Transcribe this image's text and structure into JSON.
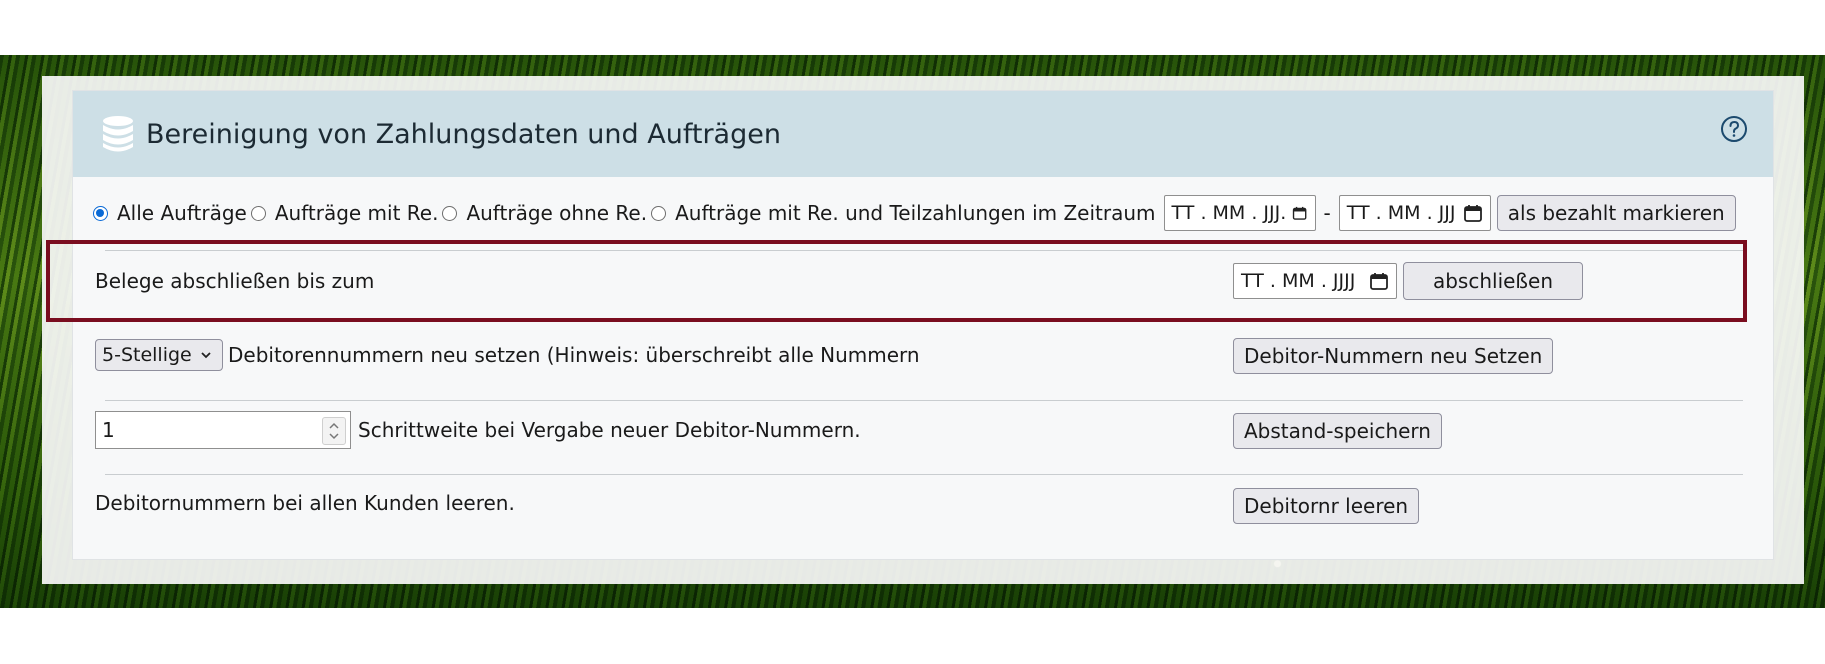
{
  "panel": {
    "title": "Bereinigung von Zahlungsdaten und Aufträgen",
    "icon": "database-icon",
    "help_icon": "question-circle-icon"
  },
  "filter": {
    "options": [
      {
        "label": "Alle Aufträge",
        "checked": true
      },
      {
        "label": "Aufträge mit Re.",
        "checked": false
      },
      {
        "label": "Aufträge ohne Re.",
        "checked": false
      },
      {
        "label": "Aufträge mit Re. und Teilzahlungen im Zeitraum",
        "checked": false
      }
    ],
    "date_from": "TT . MM . JJJ.",
    "separator": "-",
    "date_to": "TT . MM . JJJ",
    "mark_paid_button": "als bezahlt markieren"
  },
  "close_docs": {
    "label": "Belege abschließen bis zum",
    "date_placeholder": "TT . MM . JJJJ",
    "button": "abschließen"
  },
  "debitor_reset": {
    "select_value": "5-Stellige",
    "label": "Debitorennummern neu setzen (Hinweis: überschreibt alle Nummern",
    "button": "Debitor-Nummern neu Setzen"
  },
  "step": {
    "value": "1",
    "label": "Schrittweite bei Vergabe neuer Debitor-Nummern.",
    "button": "Abstand-speichern"
  },
  "clear_debitor": {
    "label": "Debitornummern bei allen Kunden leeren.",
    "button": "Debitornr leeren"
  },
  "colors": {
    "header_bg": "#cddfe6",
    "highlight_border": "#7a0d1f",
    "radio_accent": "#0a6ad6"
  }
}
